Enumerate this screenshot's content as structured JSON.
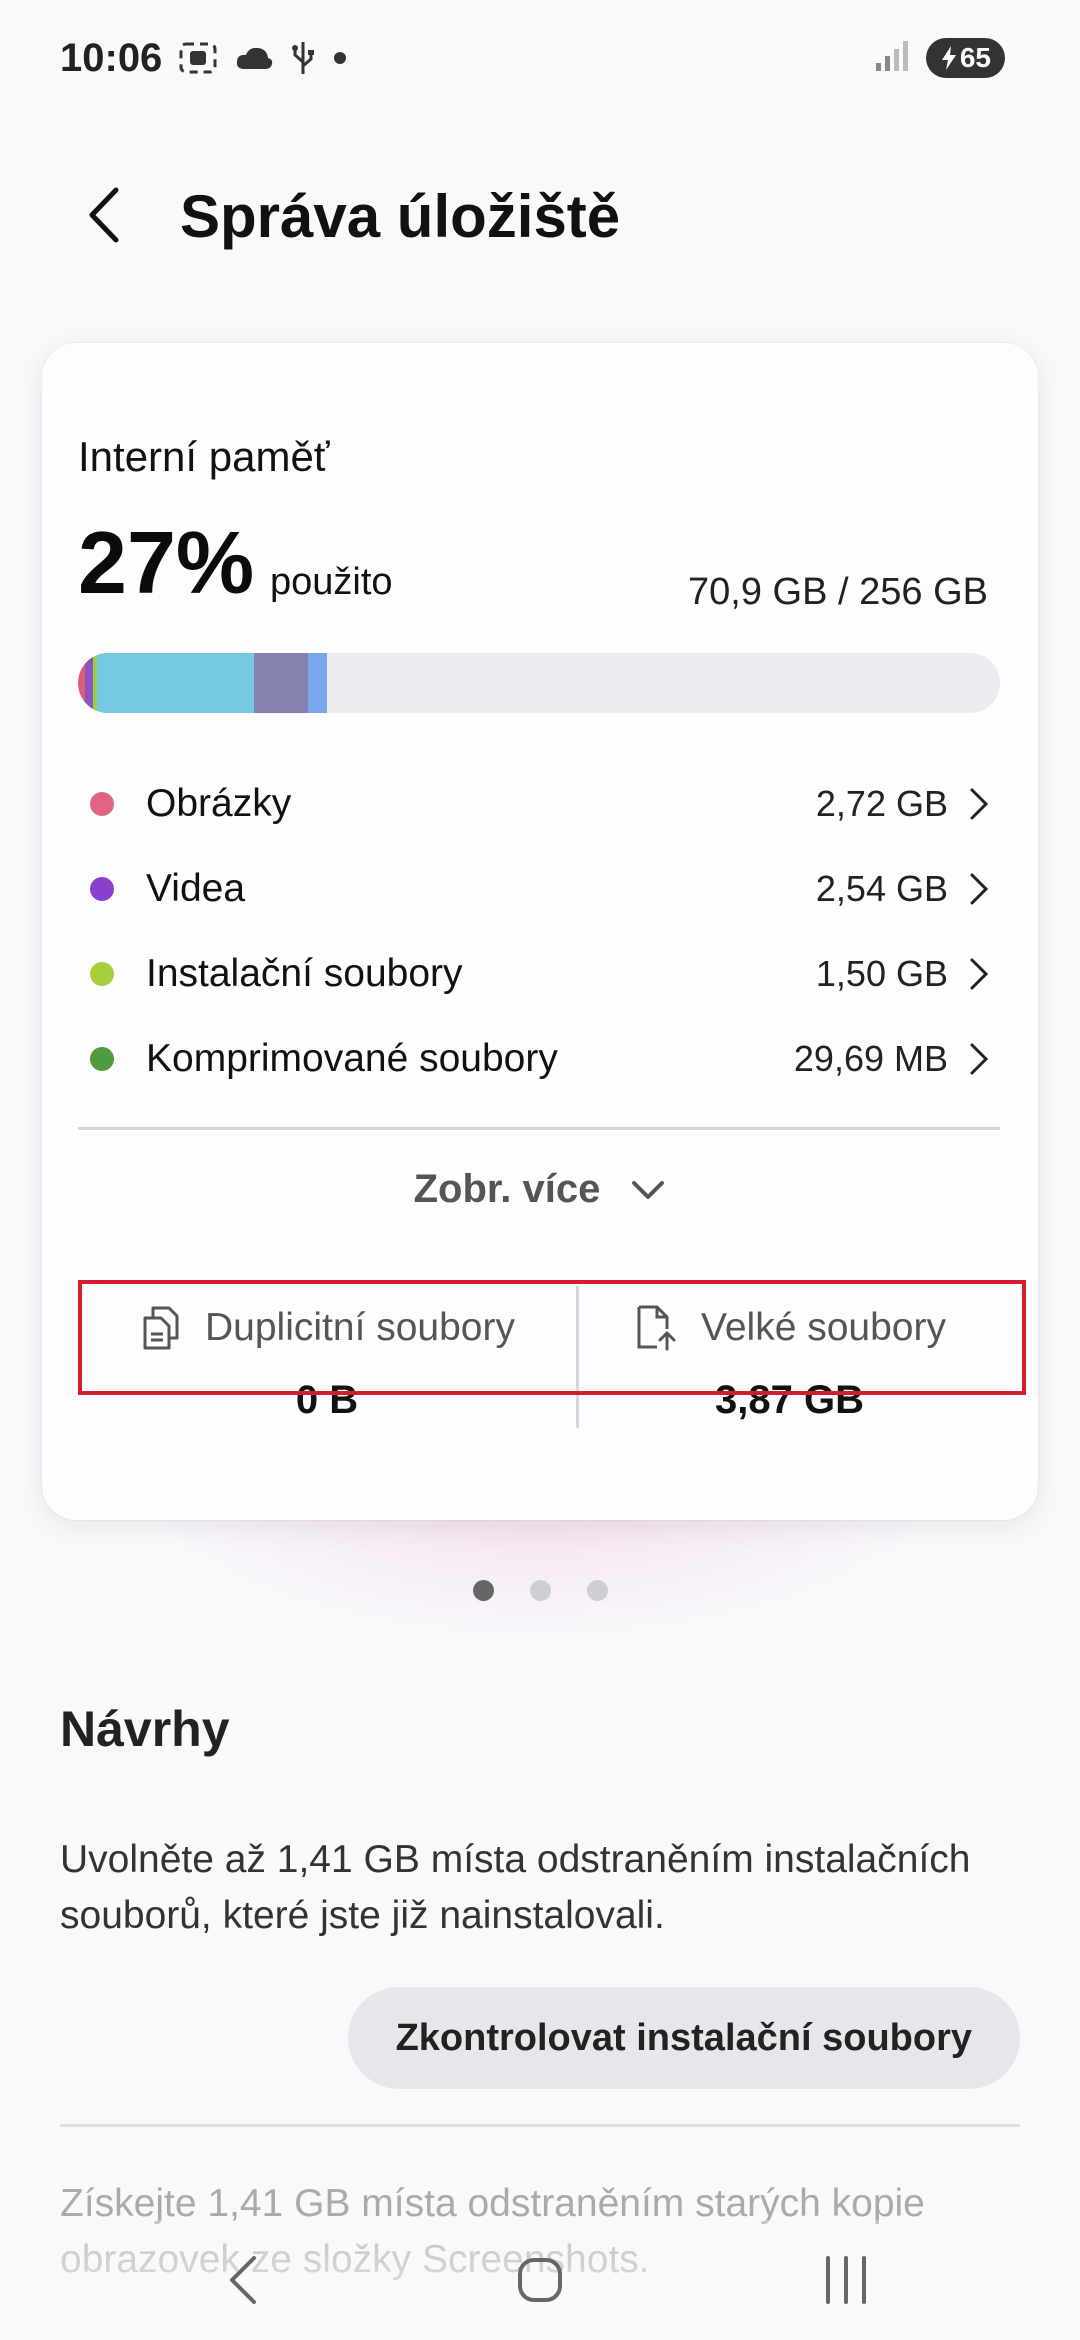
{
  "status_bar": {
    "time": "10:06",
    "battery": "65",
    "icons": [
      "screenshot-icon",
      "weather-icon",
      "usb-icon",
      "dot-icon",
      "signal-icon",
      "battery-charging-icon"
    ]
  },
  "header": {
    "title": "Správa úložiště",
    "back_icon": "back-arrow-icon"
  },
  "storage_card": {
    "title": "Interní paměť",
    "percent": "27%",
    "used_label": "použito",
    "capacity": "70,9 GB / 256 GB",
    "bar_segments": [
      {
        "name": "pink",
        "color": "#d9607c",
        "fraction": 0.008
      },
      {
        "name": "purple",
        "color": "#8b54c2",
        "fraction": 0.008
      },
      {
        "name": "lime",
        "color": "#9ccf3a",
        "fraction": 0.005
      },
      {
        "name": "light-blue",
        "color": "#75c9e3",
        "fraction": 0.17
      },
      {
        "name": "slate",
        "color": "#8582b0",
        "fraction": 0.058
      },
      {
        "name": "blue",
        "color": "#7aa6ec",
        "fraction": 0.021
      }
    ],
    "categories": [
      {
        "label": "Obrázky",
        "value": "2,72 GB",
        "color": "#e06583"
      },
      {
        "label": "Videa",
        "value": "2,54 GB",
        "color": "#8a3fcf"
      },
      {
        "label": "Instalační soubory",
        "value": "1,50 GB",
        "color": "#a4cf3b"
      },
      {
        "label": "Komprimované soubory",
        "value": "29,69 MB",
        "color": "#4e9c3e"
      }
    ],
    "show_more": "Zobr. více",
    "tools": {
      "duplicates_label": "Duplicitní soubory",
      "duplicates_value": "0 B",
      "large_label": "Velké soubory",
      "large_value": "3,87 GB"
    },
    "highlight_color": "#d51c2d"
  },
  "pager": {
    "count": 3,
    "active": 0
  },
  "suggestions": {
    "title": "Návrhy",
    "text": "Uvolněte až 1,41 GB místa odstraněním instalačních souborů, které jste již nainstalovali.",
    "button": "Zkontrolovat instalační soubory",
    "text2": "Získejte 1,41 GB místa odstraněním starých kopie obrazovek ze složky Screenshots."
  },
  "navbar": {
    "icons": [
      "nav-back-icon",
      "nav-home-icon",
      "nav-recents-icon"
    ]
  }
}
